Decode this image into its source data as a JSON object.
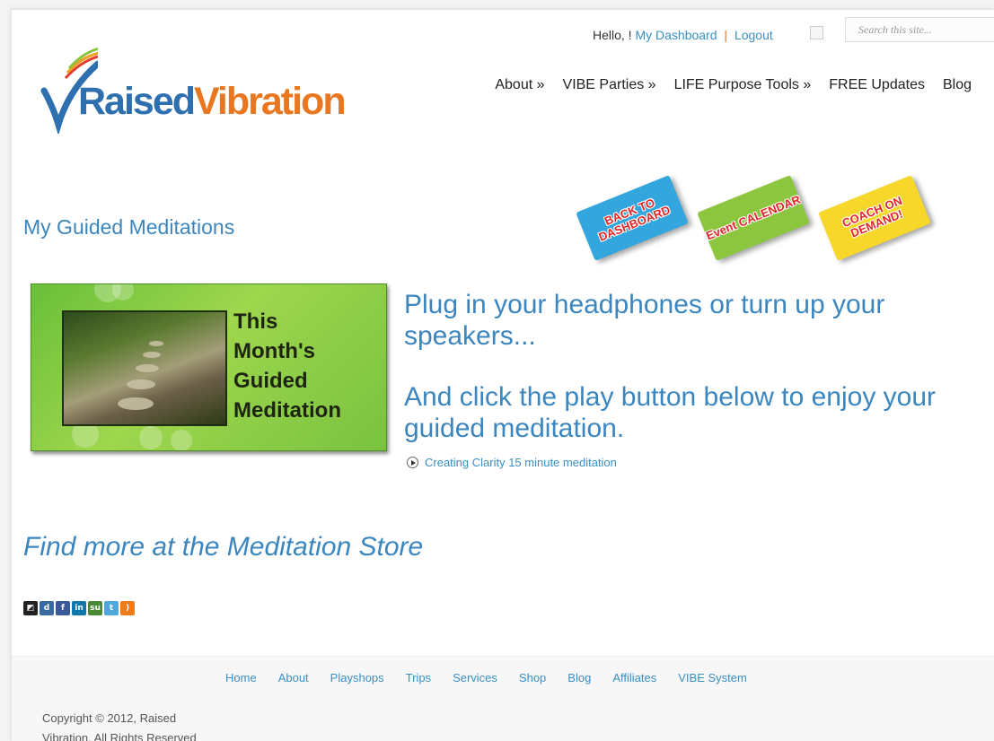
{
  "header": {
    "greeting": "Hello, !",
    "dashboard_link": "My Dashboard",
    "separator": "|",
    "logout_link": "Logout",
    "search_placeholder": "Search this site..."
  },
  "logo": {
    "part1": "Raised",
    "part2": "Vibration"
  },
  "nav": [
    "About »",
    "VIBE Parties »",
    "LIFE Purpose Tools »",
    "FREE Updates",
    "Blog"
  ],
  "page_title": "My Guided Meditations",
  "tags": [
    {
      "label": "BACK TO DASHBOARD",
      "color": "#33a6dd"
    },
    {
      "label": "Event CALENDAR",
      "color": "#8cc63f"
    },
    {
      "label": "COACH ON DEMAND!",
      "color": "#f6d72a"
    }
  ],
  "banner": {
    "lines": [
      "This",
      "Month's",
      "Guided",
      "Meditation"
    ]
  },
  "main": {
    "headline1": "Plug in your headphones or turn up your speakers...",
    "headline2": "And click the play button below to enjoy your guided meditation.",
    "track_label": "Creating Clarity 15 minute meditation",
    "store_link": "Find more at the Meditation Store"
  },
  "social_icons": [
    "delicious-icon",
    "digg-icon",
    "facebook-icon",
    "linkedin-icon",
    "stumbleupon-icon",
    "twitter-icon",
    "rss-icon"
  ],
  "footer": {
    "links": [
      "Home",
      "About",
      "Playshops",
      "Trips",
      "Services",
      "Shop",
      "Blog",
      "Affiliates",
      "VIBE System"
    ],
    "copyright": "Copyright © 2012, Raised Vibration. All Rights Reserved"
  },
  "colors": {
    "brand_blue": "#3b86bf",
    "brand_orange": "#e9771f",
    "link": "#3a8fc3",
    "banner_green": "#8cc63f"
  }
}
